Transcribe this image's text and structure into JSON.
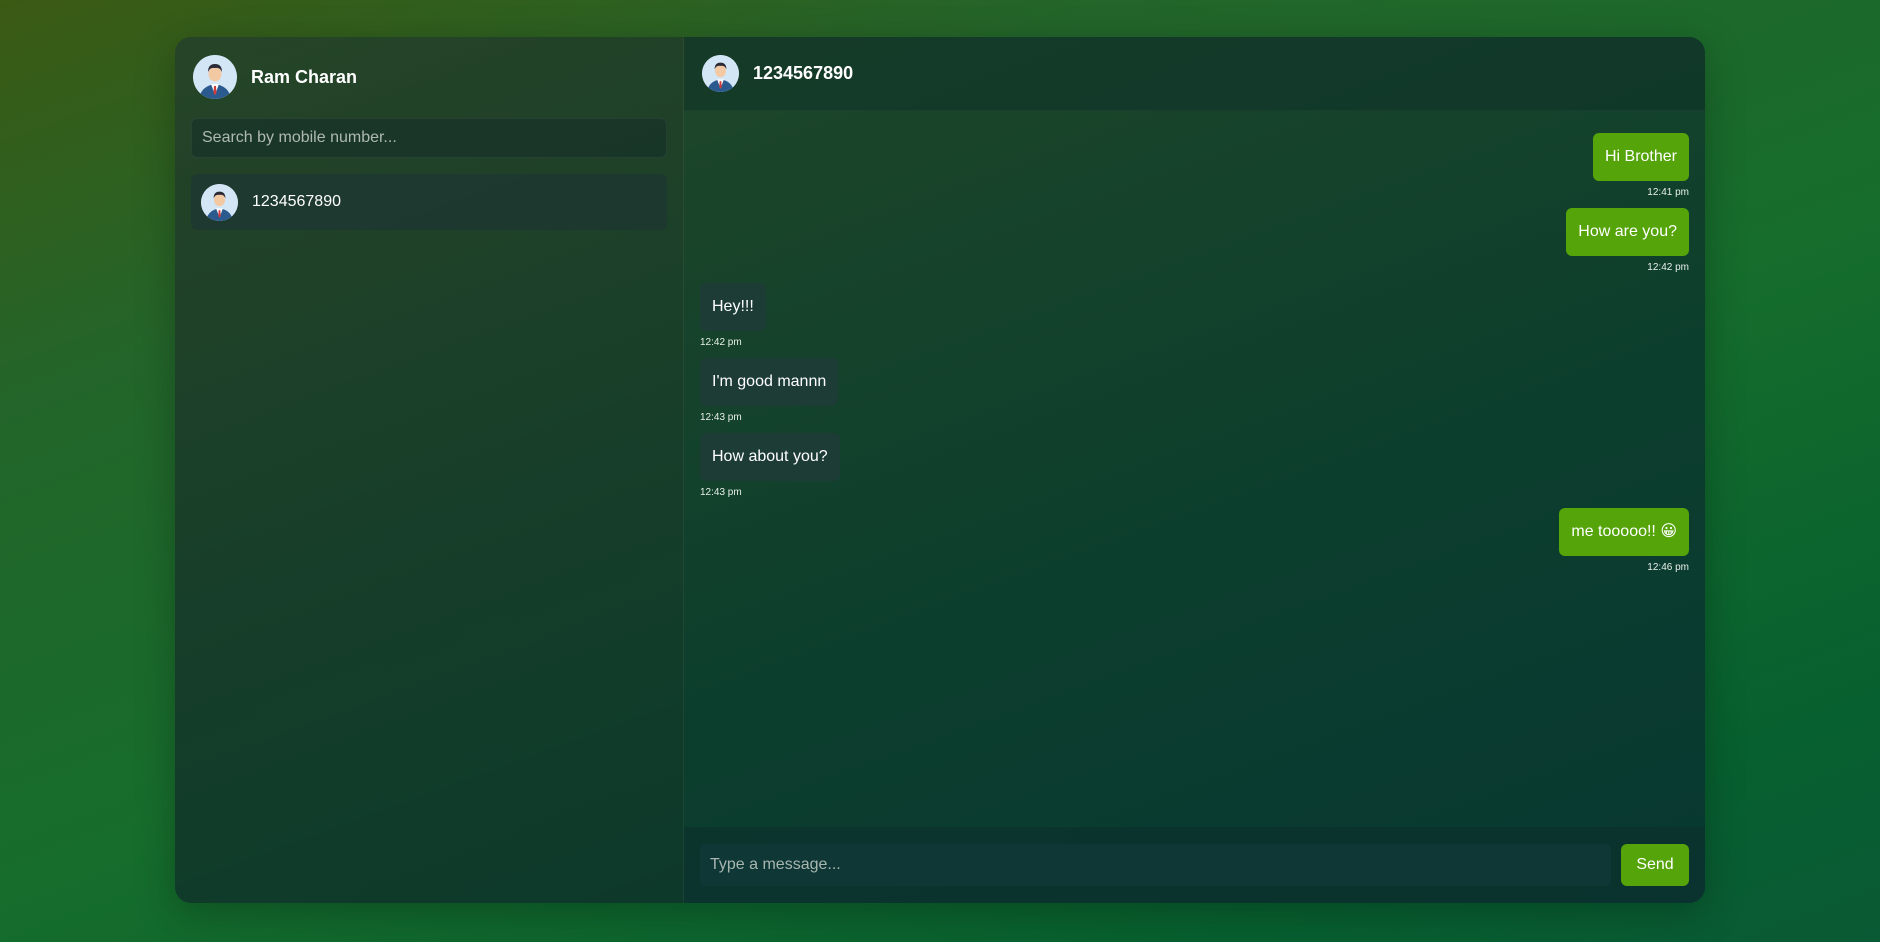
{
  "profile": {
    "name": "Ram Charan",
    "avatar_icon": "user-avatar-icon"
  },
  "search": {
    "placeholder": "Search by mobile number...",
    "value": ""
  },
  "contacts": [
    {
      "name": "1234567890",
      "avatar_icon": "user-avatar-icon",
      "active": true
    }
  ],
  "chat": {
    "title": "1234567890",
    "messages": [
      {
        "direction": "out",
        "text": "Hi Brother",
        "time": "12:41 pm"
      },
      {
        "direction": "out",
        "text": "How are you?",
        "time": "12:42 pm"
      },
      {
        "direction": "in",
        "text": "Hey!!!",
        "time": "12:42 pm"
      },
      {
        "direction": "in",
        "text": "I'm good mannn",
        "time": "12:43 pm"
      },
      {
        "direction": "in",
        "text": "How about you?",
        "time": "12:43 pm"
      },
      {
        "direction": "out",
        "text": "me tooooo!! 😀",
        "time": "12:46 pm"
      }
    ]
  },
  "composer": {
    "placeholder": "Type a message...",
    "value": "",
    "send_label": "Send"
  },
  "colors": {
    "accent": "#54a40a",
    "incoming_bubble": "#1d3c36"
  }
}
